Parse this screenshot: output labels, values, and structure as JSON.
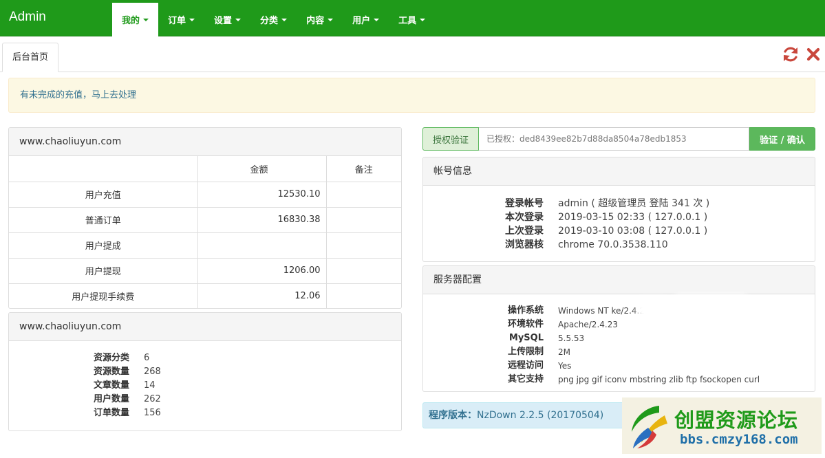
{
  "brand": "Admin",
  "nav": [
    {
      "label": "我的",
      "active": true
    },
    {
      "label": "订单",
      "active": false
    },
    {
      "label": "设置",
      "active": false
    },
    {
      "label": "分类",
      "active": false
    },
    {
      "label": "内容",
      "active": false
    },
    {
      "label": "用户",
      "active": false
    },
    {
      "label": "工具",
      "active": false
    }
  ],
  "tab": {
    "label": "后台首页"
  },
  "icons": {
    "refresh": "refresh-icon",
    "close": "close-icon"
  },
  "alert": {
    "text": "有未完成的充值，马上去处理"
  },
  "stats_panel": {
    "title": "www.chaoliuyun.com",
    "headers": [
      "",
      "金额",
      "备注"
    ],
    "rows": [
      {
        "name": "用户充值",
        "amount": "12530.10",
        "note": ""
      },
      {
        "name": "普通订单",
        "amount": "16830.38",
        "note": ""
      },
      {
        "name": "用户提成",
        "amount": "",
        "note": ""
      },
      {
        "name": "用户提现",
        "amount": "1206.00",
        "note": ""
      },
      {
        "name": "用户提现手续费",
        "amount": "12.06",
        "note": ""
      }
    ]
  },
  "resource_panel": {
    "title": "www.chaoliuyun.com",
    "items": [
      {
        "label": "资源分类",
        "value": "6"
      },
      {
        "label": "资源数量",
        "value": "268"
      },
      {
        "label": "文章数量",
        "value": "14"
      },
      {
        "label": "用户数量",
        "value": "262"
      },
      {
        "label": "订单数量",
        "value": "156"
      }
    ]
  },
  "license": {
    "label": "授权验证",
    "value": "已授权：ded8439ee82b7d88da8504a78edb1853",
    "button": "验证 / 确认"
  },
  "account_panel": {
    "title": "帐号信息",
    "items": [
      {
        "label": "登录帐号",
        "value": "admin ( 超级管理员 登陆 341 次 )"
      },
      {
        "label": "本次登录",
        "value": "2019-03-15 02:33 ( 127.0.0.1 )"
      },
      {
        "label": "上次登录",
        "value": "2019-03-10 03:08 ( 127.0.0.1 )"
      },
      {
        "label": "浏览器核",
        "value": "chrome 70.0.3538.110"
      }
    ]
  },
  "server_panel": {
    "title": "服务器配置",
    "items": [
      {
        "label": "操作系统",
        "value": "Windows NT ke/2.4.2"
      },
      {
        "label": "环境软件",
        "value": "Apache/2.4.23"
      },
      {
        "label": "MySQL",
        "value": "5.5.53"
      },
      {
        "label": "上传限制",
        "value": "2M"
      },
      {
        "label": "远程访问",
        "value": "Yes"
      },
      {
        "label": "其它支持",
        "value": "png jpg gif iconv mbstring zlib ftp fsockopen curl"
      }
    ]
  },
  "version": {
    "label": "程序版本：",
    "value": "NzDown 2.2.5 (20170504)"
  },
  "watermark": {
    "title": "创盟资源论坛",
    "url": "bbs.cmzy168.com"
  }
}
